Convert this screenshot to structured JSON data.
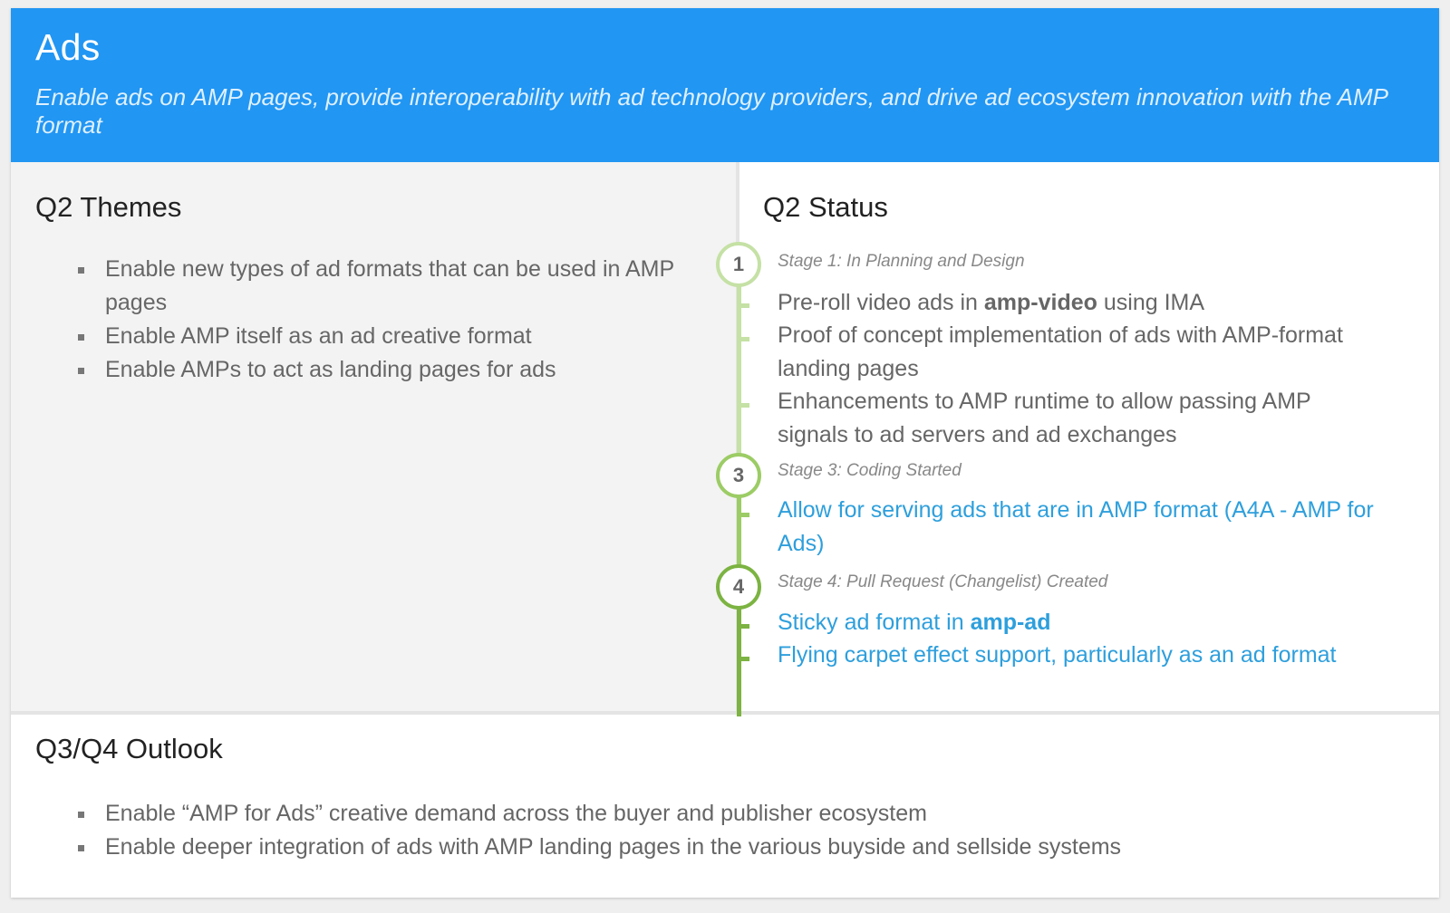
{
  "header": {
    "title": "Ads",
    "subtitle": "Enable ads on AMP pages, provide interoperability with ad technology providers, and drive ad ecosystem innovation with the AMP format"
  },
  "themes": {
    "title": "Q2 Themes",
    "items": [
      "Enable new types of ad formats that can be used in AMP pages",
      "Enable AMP itself as an ad creative format",
      "Enable AMPs to act as landing pages for ads"
    ]
  },
  "status": {
    "title": "Q2 Status",
    "stages": [
      {
        "number": "1",
        "label": "Stage 1: In Planning and Design",
        "items": [
          {
            "pre": "Pre-roll video ads in ",
            "bold": "amp-video",
            "post": " using IMA"
          },
          {
            "text": "Proof of concept implementation of ads with AMP-format landing pages"
          },
          {
            "text": "Enhancements to AMP runtime to allow passing AMP signals to ad servers and ad exchanges"
          }
        ]
      },
      {
        "number": "3",
        "label": "Stage 3: Coding Started",
        "items": [
          {
            "text": "Allow for serving ads that are in AMP format (A4A - AMP for Ads)"
          }
        ]
      },
      {
        "number": "4",
        "label": "Stage 4: Pull Request (Changelist) Created",
        "items": [
          {
            "pre": "Sticky ad format in ",
            "bold": "amp-ad",
            "post": ""
          },
          {
            "text": "Flying carpet effect support, particularly as an ad format"
          }
        ]
      }
    ]
  },
  "outlook": {
    "title": "Q3/Q4 Outlook",
    "items": [
      "Enable “AMP for Ads” creative demand across the buyer and publisher ecosystem",
      "Enable deeper integration of ads with AMP landing pages in the various buyside and sellside systems"
    ]
  },
  "colors": {
    "header_bg": "#2196f3",
    "stage1": "#c5e1a5",
    "stage3": "#9ccc65",
    "stage4": "#7cb342",
    "link": "#2e9fdc"
  }
}
